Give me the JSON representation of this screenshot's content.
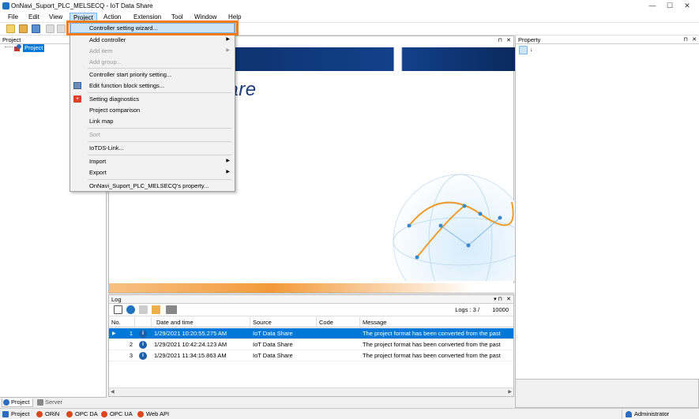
{
  "window": {
    "title": "OnNavi_Suport_PLC_MELSECQ - IoT Data Share",
    "min": "—",
    "max": "☐",
    "close": "✕"
  },
  "menubar": [
    "File",
    "Edit",
    "View",
    "Project",
    "Action",
    "Extension",
    "Tool",
    "Window",
    "Help"
  ],
  "project_panel": {
    "title": "Project",
    "pin": "⊓",
    "close": "✕",
    "tree_root": "Project",
    "tabs": [
      "Project",
      "Server"
    ]
  },
  "start_page": {
    "pin": "⊓",
    "close": "✕",
    "logo": "Share"
  },
  "project_menu": {
    "items": [
      {
        "label": "Controller setting wizard...",
        "disabled": false
      },
      {
        "label": "Add controller",
        "disabled": false,
        "submenu": true
      },
      {
        "label": "Add item",
        "disabled": true,
        "submenu": true
      },
      {
        "label": "Add group...",
        "disabled": true
      },
      {
        "label": "Controller start priority setting...",
        "disabled": false
      },
      {
        "label": "Edit function block settings...",
        "disabled": false
      },
      {
        "label": "Setting diagnostics",
        "disabled": false
      },
      {
        "label": "Project comparison",
        "disabled": false
      },
      {
        "label": "Link map",
        "disabled": false
      },
      {
        "label": "Sort",
        "disabled": true
      },
      {
        "label": "IoTDS-Link...",
        "disabled": false
      },
      {
        "label": "Import",
        "disabled": false,
        "submenu": true
      },
      {
        "label": "Export",
        "disabled": false,
        "submenu": true
      },
      {
        "label": "OnNavi_Suport_PLC_MELSECQ's property...",
        "disabled": false
      }
    ],
    "submenu_arrow": "▶"
  },
  "log": {
    "title": "Log",
    "pin": "▾ ⊓",
    "close": "✕",
    "logs_label": "Logs : 3 /",
    "max_logs": "10000",
    "columns": [
      "No.",
      "Date and time",
      "Source",
      "Code",
      "Message"
    ],
    "rows": [
      {
        "no": "1",
        "datetime": "1/29/2021 10:20:55.275 AM",
        "source": "IoT Data Share",
        "code": "",
        "message": "The project format has been converted from the past"
      },
      {
        "no": "2",
        "datetime": "1/29/2021 10:42:24.123 AM",
        "source": "IoT Data Share",
        "code": "",
        "message": "The project format has been converted from the past"
      },
      {
        "no": "3",
        "datetime": "1/29/2021 11:34:15.863 AM",
        "source": "IoT Data Share",
        "code": "",
        "message": "The project format has been converted from the past"
      }
    ]
  },
  "property_panel": {
    "title": "Property",
    "pin": "⊓",
    "close": "✕"
  },
  "statusbar": {
    "items": [
      "Project",
      "ORiN",
      "OPC DA",
      "OPC UA",
      "Web API"
    ],
    "user": "Administrator"
  },
  "colors": {
    "selection": "#0078d7",
    "highlight": "#f07d1a",
    "status_dot": "#d8481f"
  }
}
